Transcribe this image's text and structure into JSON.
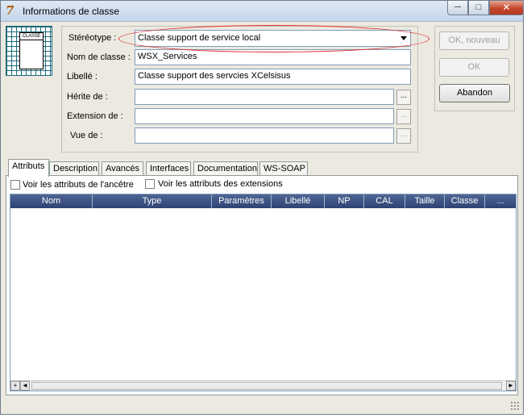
{
  "window": {
    "title": "Informations de classe",
    "icon": "app-icon",
    "controls": {
      "minimize": "─",
      "maximize": "□",
      "close": "✕"
    }
  },
  "class_icon": {
    "label": "CLASSE"
  },
  "fields": {
    "stereotype": {
      "label": "Stéréotype :",
      "value": "Classe support de service local"
    },
    "class_name": {
      "label": "Nom de classe :",
      "value": "WSX_Services"
    },
    "libelle": {
      "label": "Libellé :",
      "value": "Classe support des servcies XCelsisus"
    },
    "herite_de": {
      "label": "Hérite de :",
      "value": ""
    },
    "extension_de": {
      "label": "Extension de :",
      "value": ""
    },
    "vue_de": {
      "label": "Vue de :",
      "value": ""
    },
    "ellipsis": "..."
  },
  "buttons": {
    "ok_nouveau": "OK, nouveau",
    "ok": "OK",
    "abandon": "Abandon"
  },
  "tabs": [
    "Attributs",
    "Description",
    "Avancés",
    "Interfaces",
    "Documentation",
    "WS-SOAP"
  ],
  "checkboxes": {
    "ancestor": "Voir les attributs de l'ancêtre",
    "extensions": "Voir les attributs des extensions"
  },
  "grid": {
    "columns": [
      "Nom",
      "Type",
      "Paramètres",
      "Libellé",
      "NP",
      "CAL",
      "Taille",
      "Classe",
      "..."
    ],
    "rows": []
  },
  "scrollbar": {
    "left": "◄",
    "right": "►",
    "plus": "+"
  },
  "colors": {
    "highlight_ring": "#e03030",
    "grid_header": "#3a4f80"
  }
}
